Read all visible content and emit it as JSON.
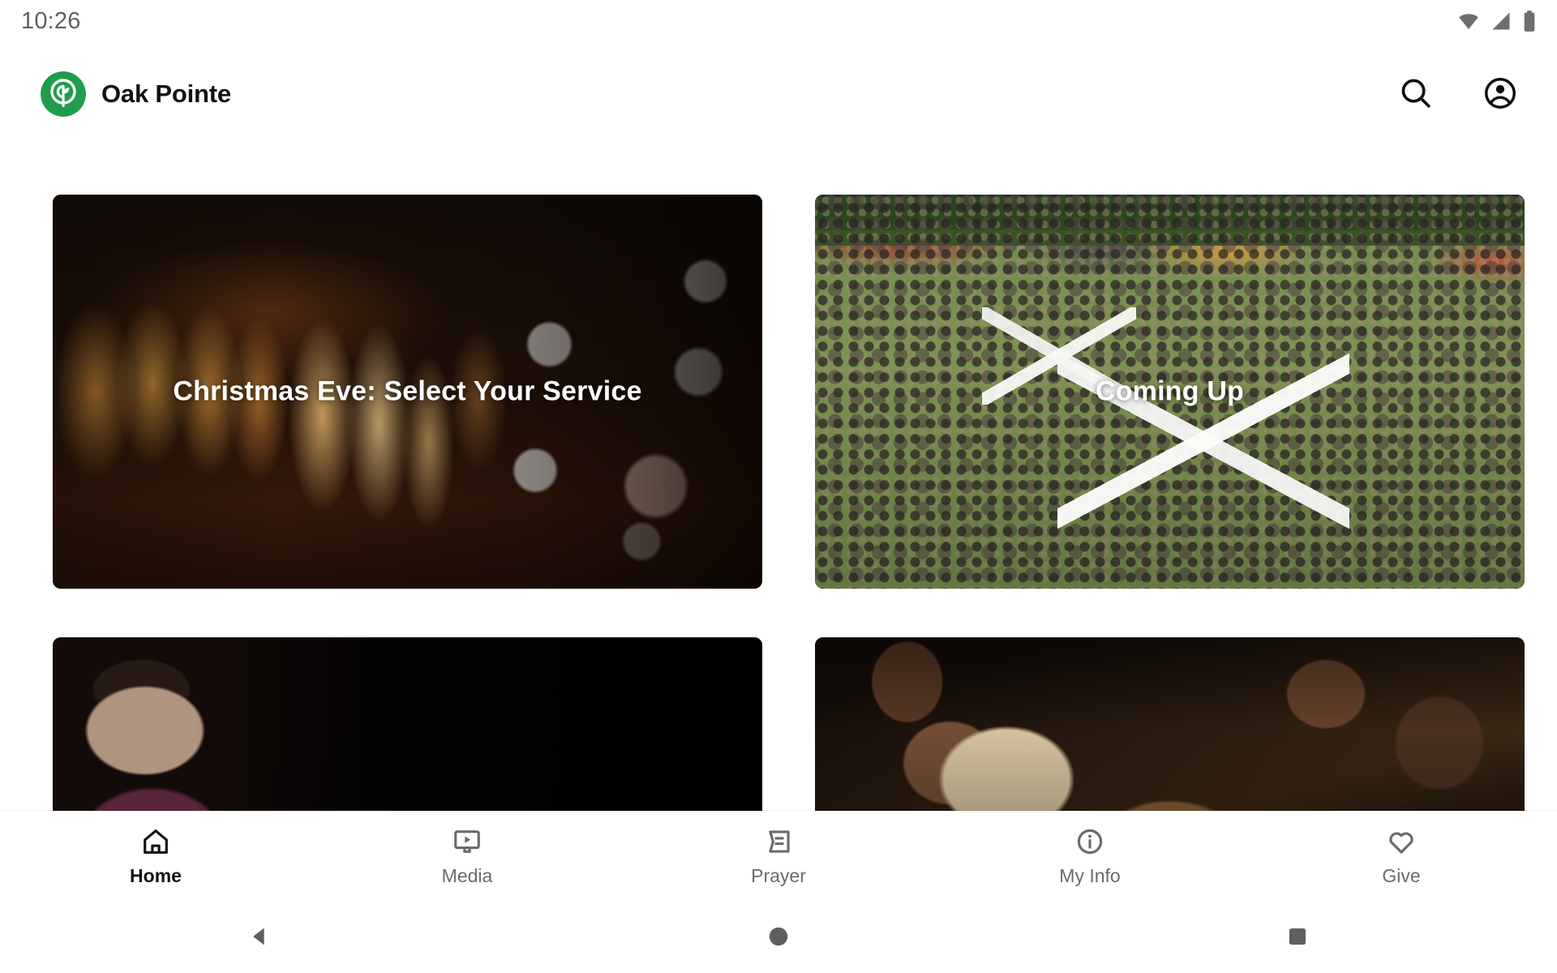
{
  "status_bar": {
    "time": "10:26",
    "icons": [
      "wifi-icon",
      "cellular-signal-icon",
      "battery-icon"
    ]
  },
  "app_bar": {
    "logo": "oak-pointe-logo",
    "brand_name": "Oak Pointe",
    "brand_color": "#1f9d4d",
    "actions": [
      {
        "name": "search-icon",
        "label": "Search"
      },
      {
        "name": "account-icon",
        "label": "Account"
      }
    ]
  },
  "main": {
    "cards": [
      {
        "title": "Christmas Eve: Select Your Service",
        "art": "candles"
      },
      {
        "title": "Coming Up",
        "art": "festival"
      },
      {
        "title": "",
        "art": "speaker"
      },
      {
        "title": "",
        "art": "audience"
      }
    ]
  },
  "tab_bar": {
    "active_index": 0,
    "tabs": [
      {
        "label": "Home",
        "icon": "home-icon"
      },
      {
        "label": "Media",
        "icon": "media-player-icon"
      },
      {
        "label": "Prayer",
        "icon": "prayer-card-icon"
      },
      {
        "label": "My Info",
        "icon": "info-circle-icon"
      },
      {
        "label": "Give",
        "icon": "heart-icon"
      }
    ]
  },
  "system_nav": {
    "buttons": [
      {
        "name": "back-button",
        "icon": "triangle-left-icon"
      },
      {
        "name": "home-button",
        "icon": "circle-icon"
      },
      {
        "name": "recents-button",
        "icon": "square-icon"
      }
    ]
  }
}
